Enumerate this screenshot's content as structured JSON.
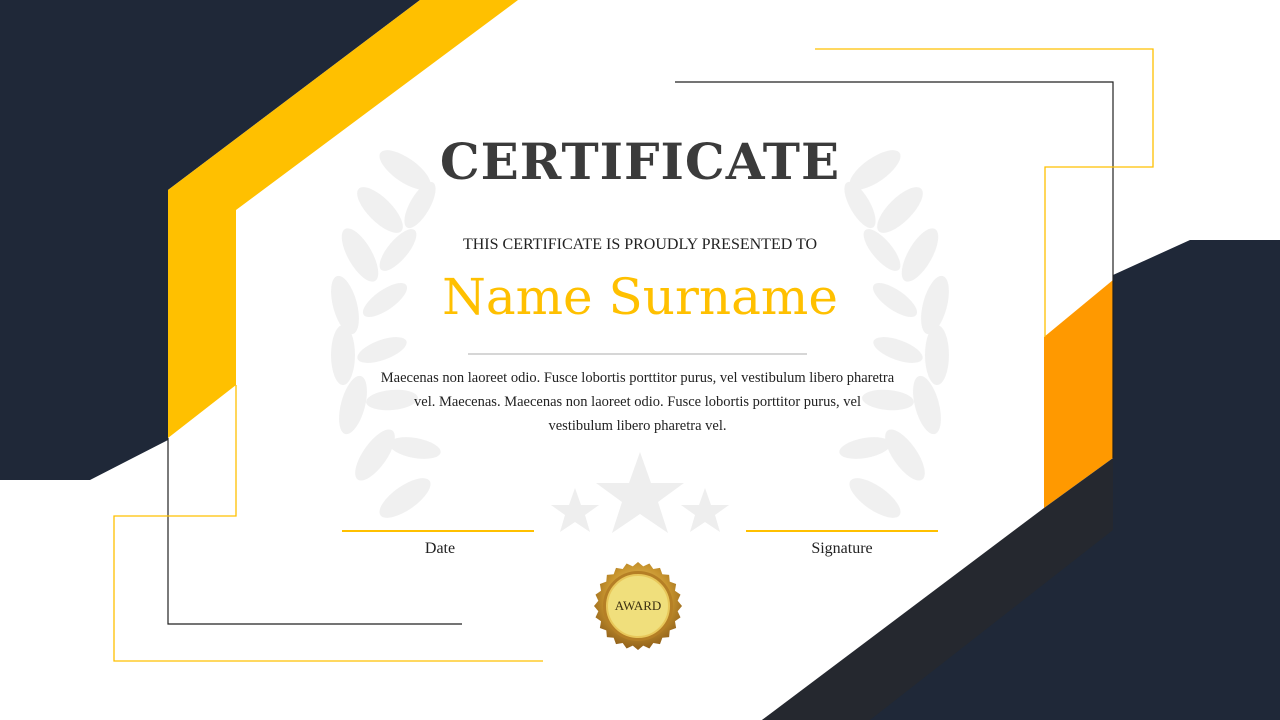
{
  "certificate": {
    "title": "CERTIFICATE",
    "subtitle": "THIS CERTIFICATE IS PROUDLY PRESENTED TO",
    "recipient_name": "Name Surname",
    "body": "Maecenas non laoreet odio. Fusce lobortis porttitor purus, vel vestibulum libero pharetra vel. Maecenas. Maecenas non laoreet odio. Fusce lobortis porttitor purus, vel vestibulum libero pharetra vel.",
    "date_label": "Date",
    "signature_label": "Signature",
    "seal_label": "AWARD"
  },
  "colors": {
    "navy": "#1f2838",
    "yellow": "#ffc000",
    "orange": "#ff9900",
    "title_gray": "#3b3b3b",
    "watermark": "#eeeeee",
    "gold": "#c8952e"
  },
  "icons": {
    "watermark": "laurel-wreath-icon",
    "stars": "star-icon",
    "seal": "award-seal-icon"
  }
}
